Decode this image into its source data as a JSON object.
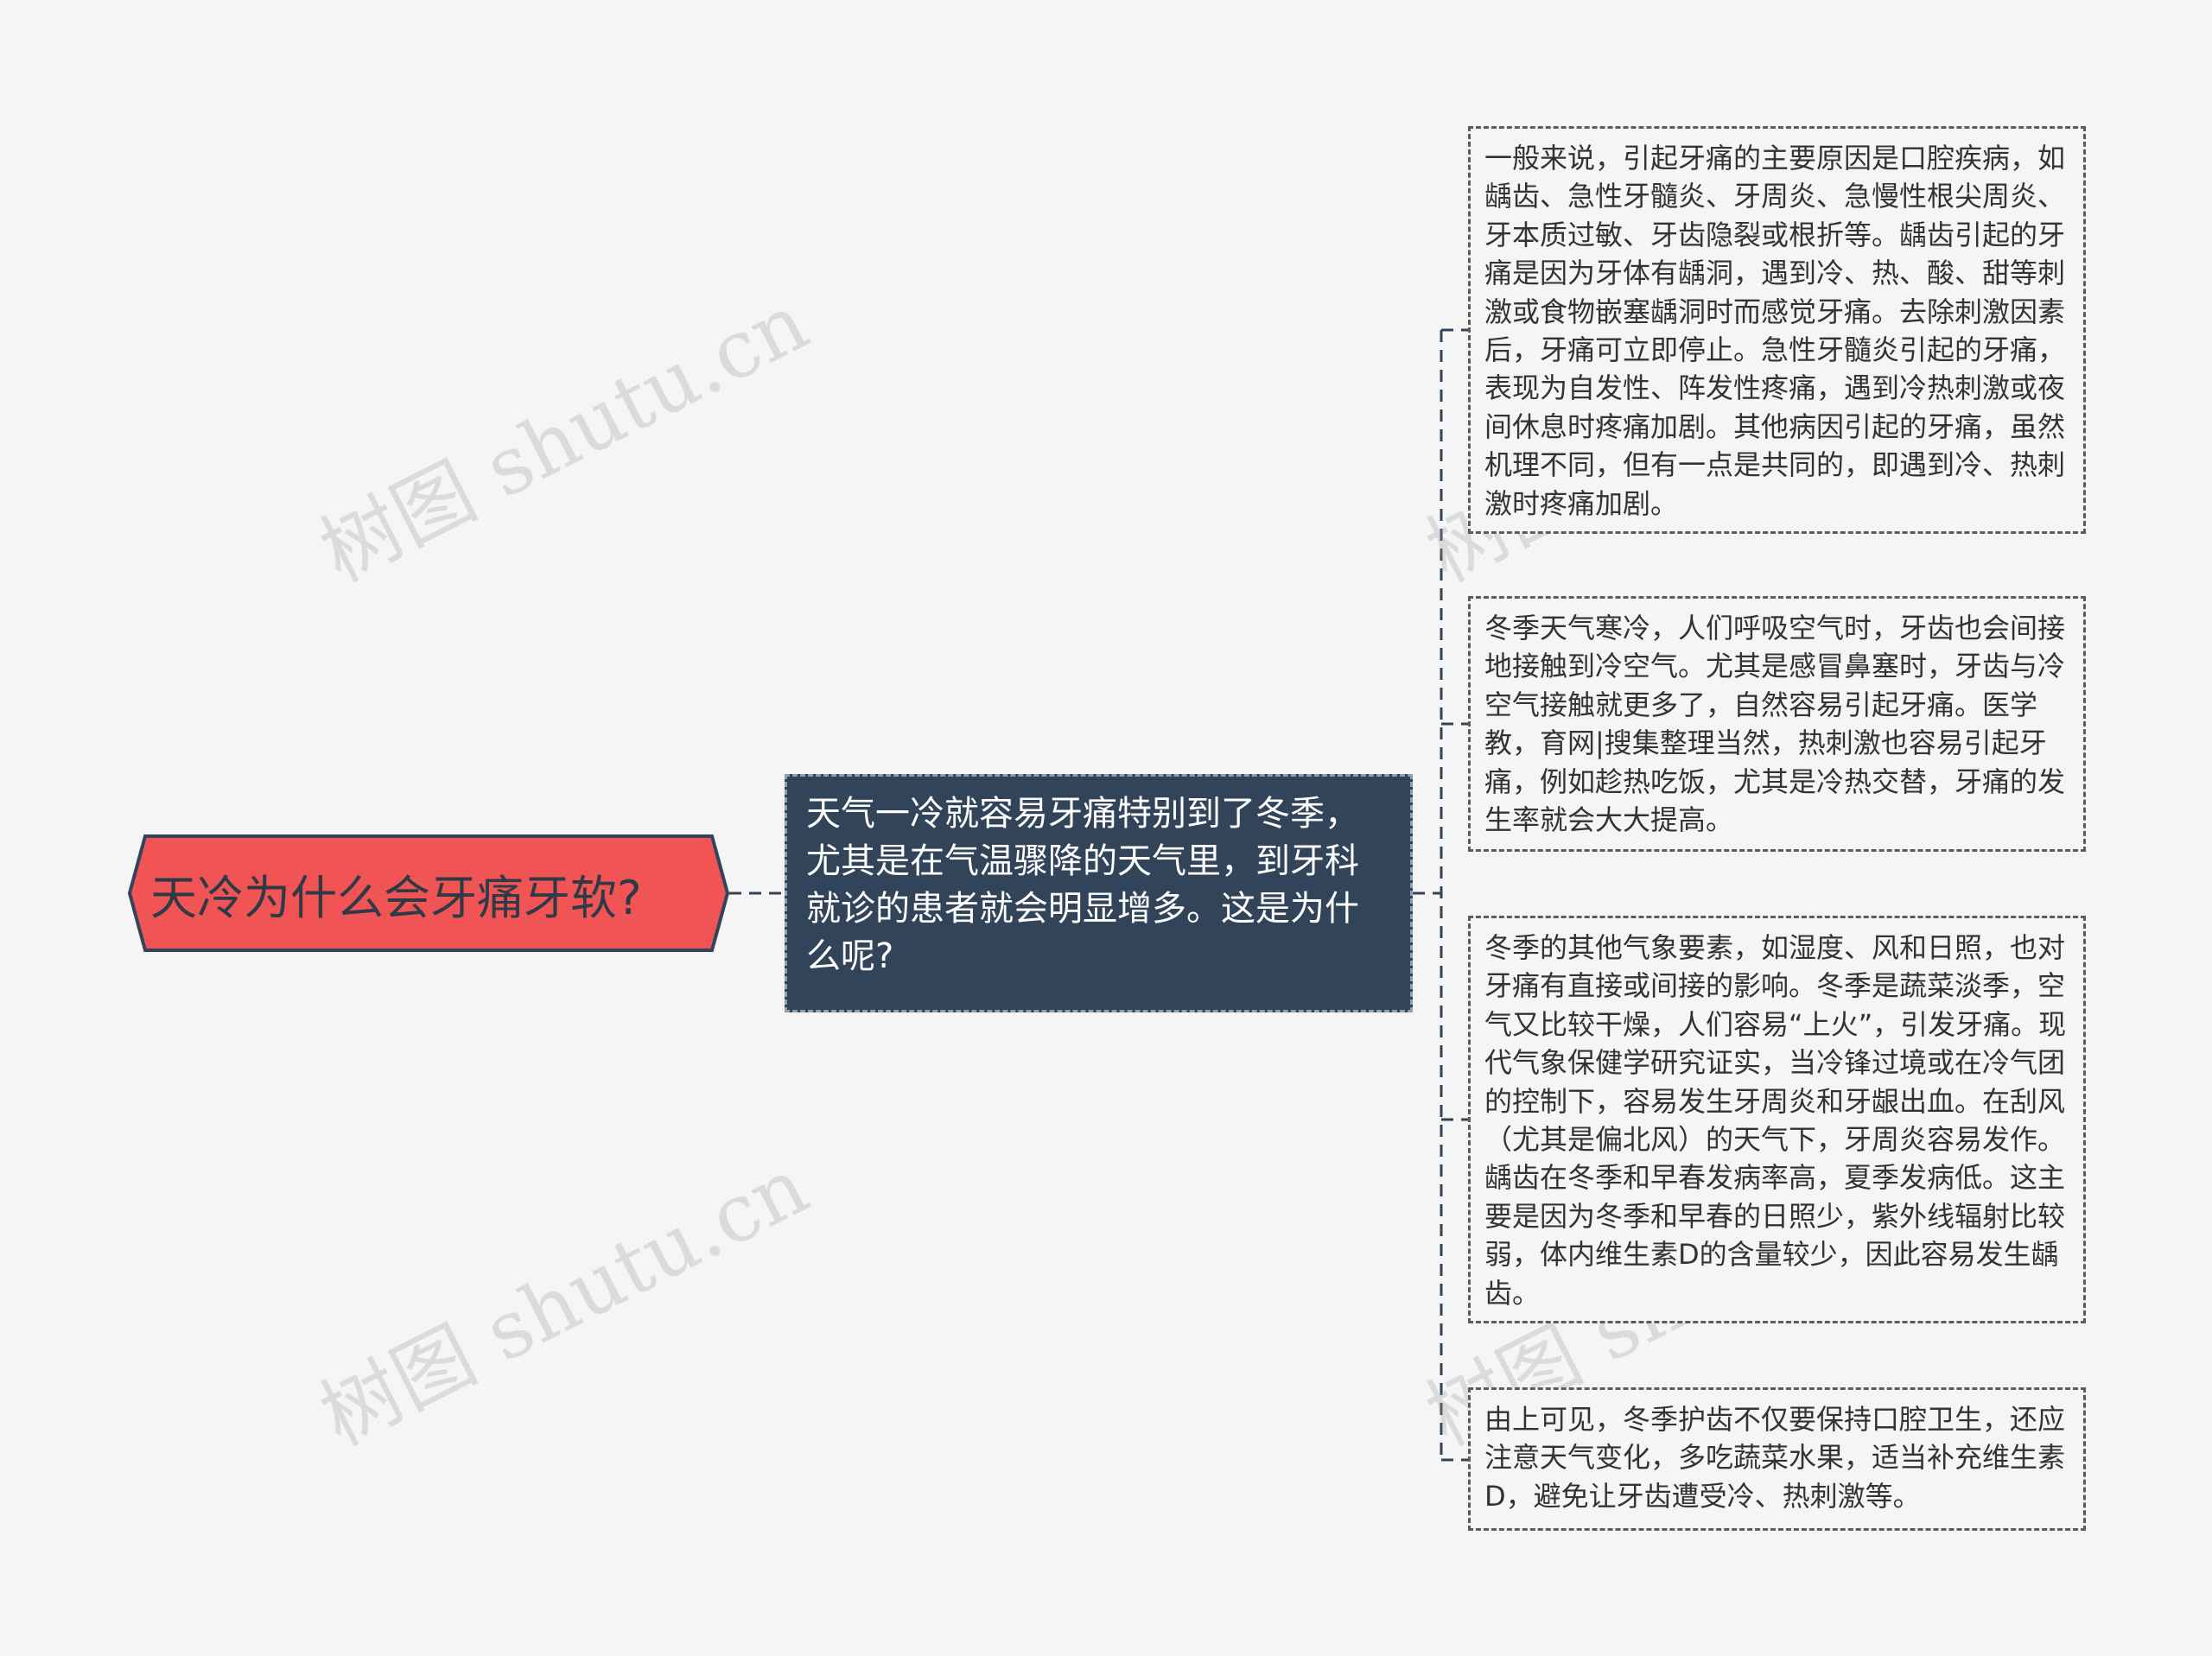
{
  "watermark": "树图 shutu.cn",
  "colors": {
    "background": "#f5f5f5",
    "root_fill": "#f05454",
    "root_border": "#314459",
    "mid_fill": "#314459",
    "mid_border": "#8fa0b3",
    "leaf_border": "#5c5c5c",
    "connector": "#314459"
  },
  "root": {
    "label": "天冷为什么会牙痛牙软?"
  },
  "mid": {
    "label": "天气一冷就容易牙痛特别到了冬季，尤其是在气温骤降的天气里，到牙科就诊的患者就会明显增多。这是为什么呢?"
  },
  "leaves": [
    {
      "text": "一般来说，引起牙痛的主要原因是口腔疾病，如龋齿、急性牙髓炎、牙周炎、急慢性根尖周炎、牙本质过敏、牙齿隐裂或根折等。龋齿引起的牙痛是因为牙体有龋洞，遇到冷、热、酸、甜等刺激或食物嵌塞龋洞时而感觉牙痛。去除刺激因素后，牙痛可立即停止。急性牙髓炎引起的牙痛，表现为自发性、阵发性疼痛，遇到冷热刺激或夜间休息时疼痛加剧。其他病因引起的牙痛，虽然机理不同，但有一点是共同的，即遇到冷、热刺激时疼痛加剧。"
    },
    {
      "text": "冬季天气寒冷，人们呼吸空气时，牙齿也会间接地接触到冷空气。尤其是感冒鼻塞时，牙齿与冷空气接触就更多了，自然容易引起牙痛。医学教，育网|搜集整理当然，热刺激也容易引起牙痛，例如趁热吃饭，尤其是冷热交替，牙痛的发生率就会大大提高。"
    },
    {
      "text": "冬季的其他气象要素，如湿度、风和日照，也对牙痛有直接或间接的影响。冬季是蔬菜淡季，空气又比较干燥，人们容易“上火”，引发牙痛。现代气象保健学研究证实，当冷锋过境或在冷气团的控制下，容易发生牙周炎和牙龈出血。在刮风（尤其是偏北风）的天气下，牙周炎容易发作。龋齿在冬季和早春发病率高，夏季发病低。这主要是因为冬季和早春的日照少，紫外线辐射比较弱，体内维生素D的含量较少，因此容易发生龋齿。"
    },
    {
      "text": "由上可见，冬季护齿不仅要保持口腔卫生，还应注意天气变化，多吃蔬菜水果，适当补充维生素D，避免让牙齿遭受冷、热刺激等。"
    }
  ]
}
